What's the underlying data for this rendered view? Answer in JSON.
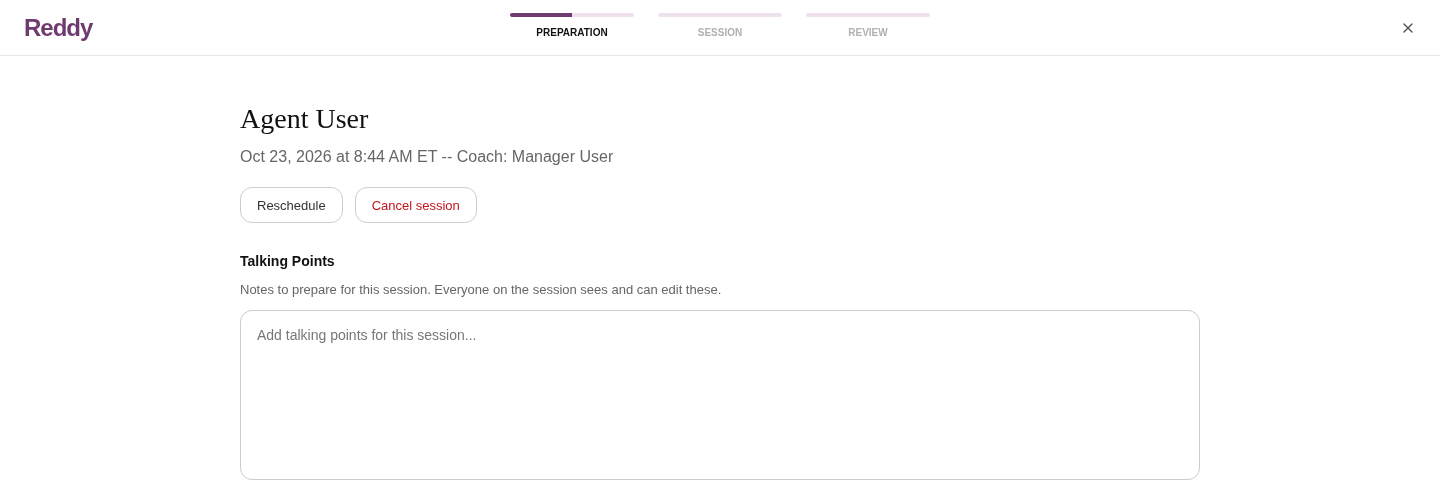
{
  "header": {
    "logo": "Reddy",
    "steps": [
      {
        "label": "PREPARATION",
        "selected": true,
        "level": 0.5
      },
      {
        "label": "SESSION",
        "selected": false
      },
      {
        "label": "REVIEW",
        "selected": false
      }
    ]
  },
  "title": "Agent User",
  "subtitle": "Oct 23, 2026 at 8:44 AM ET -- Coach: Manager User",
  "buttons": [
    {
      "label": "Reschedule",
      "kind": "default"
    },
    {
      "label": "Cancel session",
      "kind": "danger"
    }
  ],
  "talking_points": {
    "heading": "Talking Points",
    "description": "Notes to prepare for this session. Everyone on the session sees and can edit these.",
    "placeholder": "Add talking points for this session..."
  }
}
